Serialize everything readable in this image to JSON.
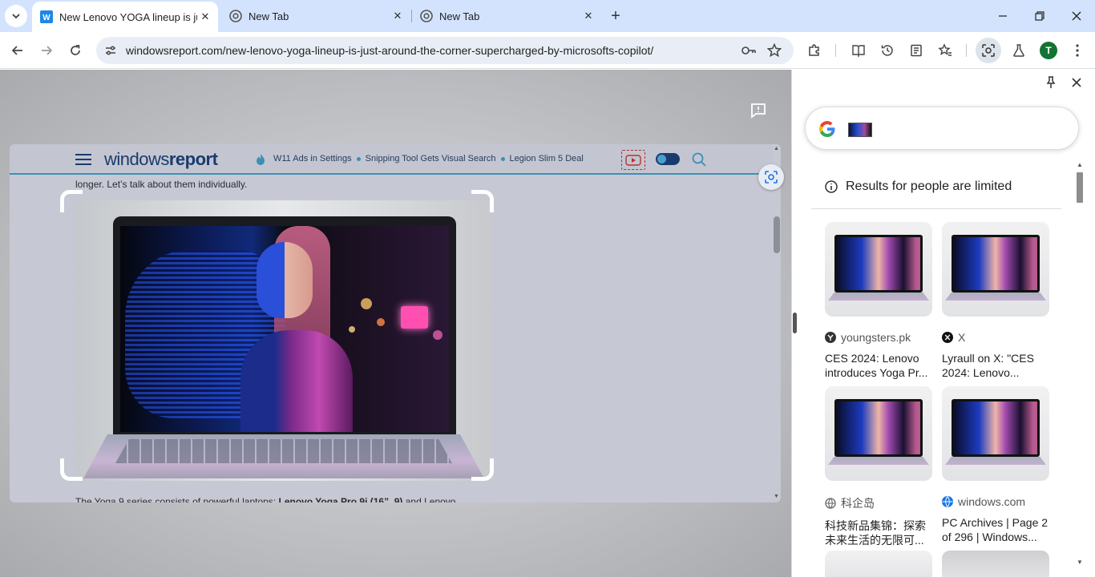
{
  "tabs": [
    {
      "title": "New Lenovo YOGA lineup is jus",
      "favicon": "windowsreport-w-icon",
      "active": true
    },
    {
      "title": "New Tab",
      "favicon": "chrome-icon",
      "active": false
    },
    {
      "title": "New Tab",
      "favicon": "chrome-icon",
      "active": false
    }
  ],
  "toolbar": {
    "url": "windowsreport.com/new-lenovo-yoga-lineup-is-just-around-the-corner-supercharged-by-microsofts-copilot/",
    "avatar_letter": "T"
  },
  "site": {
    "logo_part1": "windows",
    "logo_part2": "report",
    "trending": [
      "W11 Ads in Settings",
      "Snipping Tool Gets Visual Search",
      "Legion Slim 5 Deal"
    ],
    "article_top": "longer. Let’s talk about them individually.",
    "article_bottom_start": "The Yoga 9 series consists of powerful laptops: ",
    "article_bottom_bold": "Lenovo Yoga Pro 9i (16”, 9)",
    "article_bottom_end": " and Lenovo"
  },
  "side_panel": {
    "notice": "Results for people are limited",
    "results": [
      {
        "source": "youngsters.pk",
        "source_icon": "youngsters-y-icon",
        "title": "CES 2024: Lenovo introduces Yoga Pr..."
      },
      {
        "source": "X",
        "source_icon": "x-logo-icon",
        "title": "Lyraull on X: \"CES 2024: Lenovo..."
      },
      {
        "source": "科企岛",
        "source_icon": "globe-icon",
        "title": "科技新品集锦：探索未来生活的无限可..."
      },
      {
        "source": "windows.com",
        "source_icon": "windows-globe-icon",
        "title": "PC Archives | Page 2 of 296 | Windows..."
      }
    ]
  },
  "colors": {
    "tabstrip": "#d3e3fd",
    "omnibox": "#e9eef6",
    "brand_blue": "#1a3b6d",
    "accent": "#3d8fb5"
  }
}
